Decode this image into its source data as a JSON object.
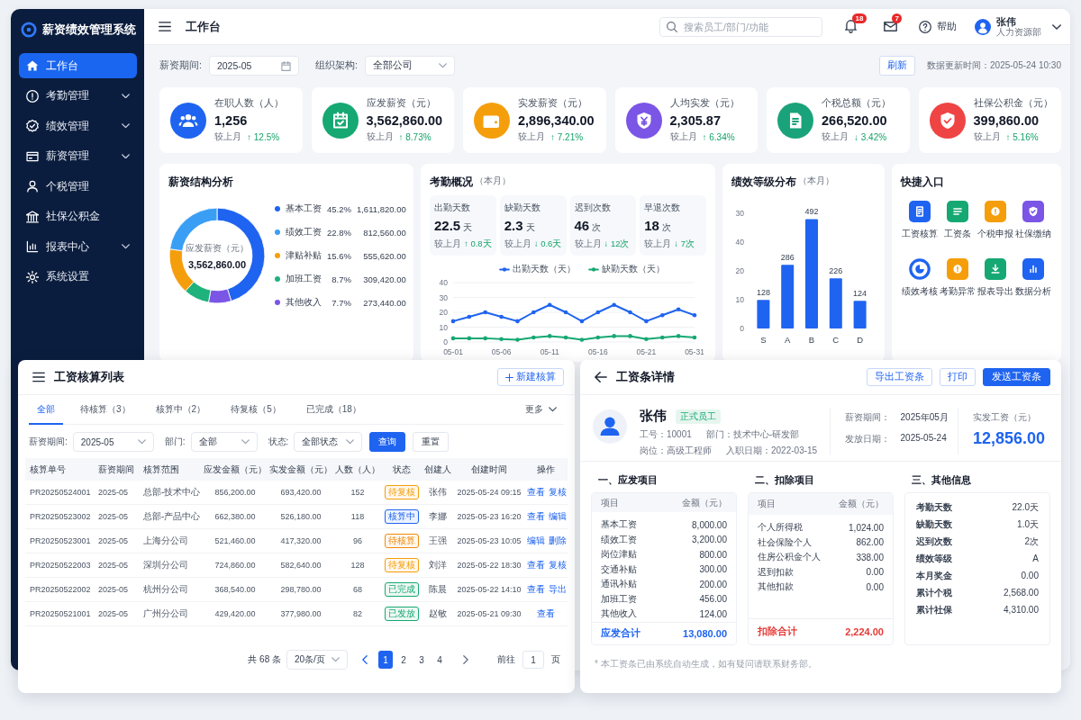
{
  "sidebar": {
    "title": "薪资绩效管理系统",
    "items": [
      {
        "label": "工作台",
        "kind": "link",
        "selected": true
      },
      {
        "label": "考勤管理",
        "kind": "group",
        "selected": false
      },
      {
        "label": "绩效管理",
        "kind": "group",
        "selected": false
      },
      {
        "label": "薪资管理",
        "kind": "group",
        "selected": false
      },
      {
        "label": "个税管理",
        "kind": "link",
        "selected": false
      },
      {
        "label": "社保公积金",
        "kind": "link",
        "selected": false
      },
      {
        "label": "报表中心",
        "kind": "group",
        "selected": false
      },
      {
        "label": "系统设置",
        "kind": "link",
        "selected": false
      }
    ]
  },
  "header": {
    "title": "工作台",
    "search": {
      "placeholder": "搜索员工/部门/功能"
    },
    "notifications": {
      "count": "18"
    },
    "messages": {
      "count": "7"
    },
    "help": {
      "label": "帮助"
    },
    "user": {
      "name": "张伟",
      "department": "人力资源部"
    }
  },
  "filters": {
    "period": {
      "label": "薪资期间:",
      "value": "2025-05"
    },
    "org": {
      "label": "组织架构:",
      "value": "全部公司"
    },
    "refresh_button": "刷新",
    "updated_at": "数据更新时间：2025-05-24 10:30"
  },
  "stats": [
    {
      "label": "在职人数（人）",
      "value": "1,256",
      "compare_label": "较上月",
      "change": "↑ 12.5%",
      "color": "#1f64f0"
    },
    {
      "label": "应发薪资（元）",
      "value": "3,562,860.00",
      "compare_label": "较上月",
      "change": "↑ 8.73%",
      "color": "#16a873"
    },
    {
      "label": "实发薪资（元）",
      "value": "2,896,340.00",
      "compare_label": "较上月",
      "change": "↑ 7.21%",
      "color": "#f59e0b"
    },
    {
      "label": "人均实发（元）",
      "value": "2,305.87",
      "compare_label": "较上月",
      "change": "↑ 6.34%",
      "color": "#7b55e6"
    },
    {
      "label": "个税总额（元）",
      "value": "266,520.00",
      "compare_label": "较上月",
      "change": "↓ 3.42%",
      "color": "#1aa37a"
    },
    {
      "label": "社保公积金（元）",
      "value": "399,860.00",
      "compare_label": "较上月",
      "change": "↑ 5.16%",
      "color": "#ef4444"
    }
  ],
  "salary_structure": {
    "title": "薪资结构分析",
    "center_label": "应发薪资（元）",
    "center_value": "3,562,860.00",
    "chart_data": {
      "type": "donut",
      "categories": [
        "基本工资",
        "绩效工资",
        "津贴补贴",
        "加班工资",
        "其他收入"
      ],
      "values": [
        45.2,
        22.8,
        15.6,
        8.7,
        7.7
      ]
    },
    "legend": [
      {
        "percent": "45.2%",
        "amount": "1,611,820.00",
        "color": "#1f64f0"
      },
      {
        "percent": "22.8%",
        "amount": "812,560.00",
        "color": "#3b9ef5"
      },
      {
        "percent": "15.6%",
        "amount": "555,620.00",
        "color": "#f59e0b"
      },
      {
        "percent": "8.7%",
        "amount": "309,420.00",
        "color": "#1fb27d"
      },
      {
        "percent": "7.7%",
        "amount": "273,440.00",
        "color": "#7b55e6"
      }
    ]
  },
  "attendance": {
    "title": "考勤概况",
    "title_note": "（本月）",
    "metrics": [
      {
        "label": "出勤天数",
        "value": "22.5",
        "unit": "天",
        "compare_label": "较上月",
        "change": "↑ 0.8天"
      },
      {
        "label": "缺勤天数",
        "value": "2.3",
        "unit": "天",
        "compare_label": "较上月",
        "change": "↓ 0.6天"
      },
      {
        "label": "迟到次数",
        "value": "46",
        "unit": "次",
        "compare_label": "较上月",
        "change": "↓ 12次"
      },
      {
        "label": "早退次数",
        "value": "18",
        "unit": "次",
        "compare_label": "较上月",
        "change": "↓ 7次"
      }
    ],
    "chart_data": {
      "type": "line",
      "categories": [
        "05-01",
        null,
        null,
        "05-06",
        null,
        null,
        "05-11",
        null,
        null,
        "05-16",
        null,
        null,
        "05-21",
        null,
        null,
        "05-31"
      ],
      "ylim": [
        0,
        40
      ],
      "yticks": [
        0,
        10,
        20,
        30,
        40
      ],
      "grid": true,
      "legend": "top",
      "series": [
        {
          "name": "出勤天数（天）",
          "color": "#1f64f0",
          "values": [
            14,
            17,
            20,
            17,
            14,
            20,
            25,
            20,
            14,
            20,
            25,
            20,
            14,
            18,
            22,
            18
          ]
        },
        {
          "name": "缺勤天数（天）",
          "color": "#16a873",
          "values": [
            2.5,
            2.5,
            2.5,
            2,
            1.5,
            3,
            4,
            3,
            1.5,
            3,
            4,
            4,
            2,
            3,
            4,
            3
          ]
        }
      ]
    }
  },
  "performance": {
    "title": "绩效等级分布",
    "title_note": "（本月）",
    "y_axis_labels": [
      "30",
      "40",
      "20",
      "10",
      "0"
    ],
    "chart_data": {
      "type": "bar",
      "categories": [
        "S",
        "A",
        "B",
        "C",
        "D"
      ],
      "values": [
        128,
        286,
        492,
        226,
        124
      ],
      "data_labels": true
    }
  },
  "quick_entry": {
    "title": "快捷入口",
    "items": [
      {
        "label": "工资核算",
        "color": "#1f64f0"
      },
      {
        "label": "工资条",
        "color": "#16a873"
      },
      {
        "label": "个税申报",
        "color": "#f59e0b"
      },
      {
        "label": "社保缴纳",
        "color": "#7b55e6"
      },
      {
        "label": "绩效考核",
        "color": "#1f64f0"
      },
      {
        "label": "考勤异常",
        "color": "#f59e0b"
      },
      {
        "label": "报表导出",
        "color": "#16a873"
      },
      {
        "label": "数据分析",
        "color": "#1f64f0"
      }
    ]
  },
  "payroll_list": {
    "title": "工资核算列表",
    "new_button": "新建核算",
    "tabs": [
      {
        "label": "全部",
        "selected": true
      },
      {
        "label": "待核算（3）",
        "selected": false
      },
      {
        "label": "核算中（2）",
        "selected": false
      },
      {
        "label": "待复核（5）",
        "selected": false
      },
      {
        "label": "已完成（18）",
        "selected": false
      }
    ],
    "more": "更多",
    "filters": [
      {
        "label": "薪资期间:",
        "value": "2025-05"
      },
      {
        "label": "部门:",
        "value": "全部"
      },
      {
        "label": "状态:",
        "value": "全部状态"
      }
    ],
    "query_button": "查询",
    "reset_button": "重置",
    "table": {
      "columns": [
        "核算单号",
        "薪资期间",
        "核算范围",
        "应发金额（元）",
        "实发金额（元）",
        "人数（人）",
        "状态",
        "创建人",
        "创建时间",
        "操作"
      ],
      "rows": [
        {
          "cells": [
            "PR20250524001",
            "2025-05",
            "总部-技术中心",
            "856,200.00",
            "693,420.00",
            "152"
          ],
          "status": {
            "label": "待复核",
            "color": "#f59e0b"
          },
          "creator": "张伟",
          "created_at": "2025-05-24 09:15",
          "actions": [
            "查看",
            "复核"
          ]
        },
        {
          "cells": [
            "PR20250523002",
            "2025-05",
            "总部-产品中心",
            "662,380.00",
            "526,180.00",
            "118"
          ],
          "status": {
            "label": "核算中",
            "color": "#1f64f0"
          },
          "creator": "李娜",
          "created_at": "2025-05-23 16:20",
          "actions": [
            "查看",
            "编辑"
          ]
        },
        {
          "cells": [
            "PR20250523001",
            "2025-05",
            "上海分公司",
            "521,460.00",
            "417,320.00",
            "96"
          ],
          "status": {
            "label": "待核算",
            "color": "#f08c0c"
          },
          "creator": "王强",
          "created_at": "2025-05-23 10:05",
          "actions": [
            "编辑",
            "删除"
          ]
        },
        {
          "cells": [
            "PR20250522003",
            "2025-05",
            "深圳分公司",
            "724,860.00",
            "582,640.00",
            "128"
          ],
          "status": {
            "label": "待复核",
            "color": "#f59e0b"
          },
          "creator": "刘洋",
          "created_at": "2025-05-22 18:30",
          "actions": [
            "查看",
            "复核"
          ]
        },
        {
          "cells": [
            "PR20250522002",
            "2025-05",
            "杭州分公司",
            "368,540.00",
            "298,780.00",
            "68"
          ],
          "status": {
            "label": "已完成",
            "color": "#16a873"
          },
          "creator": "陈晨",
          "created_at": "2025-05-22 14:10",
          "actions": [
            "查看",
            "导出"
          ]
        },
        {
          "cells": [
            "PR20250521001",
            "2025-05",
            "广州分公司",
            "429,420.00",
            "377,980.00",
            "82"
          ],
          "status": {
            "label": "已发放",
            "color": "#16a873"
          },
          "creator": "赵敏",
          "created_at": "2025-05-21 09:30",
          "actions": [
            "查看"
          ]
        }
      ]
    },
    "pagination": {
      "total": "共 68 条",
      "page_size": "20条/页",
      "pages": [
        {
          "label": "1",
          "selected": true
        },
        {
          "label": "2",
          "selected": false
        },
        {
          "label": "3",
          "selected": false
        },
        {
          "label": "4",
          "selected": false
        }
      ],
      "goto_label": "前往",
      "goto_value": "1",
      "goto_suffix": "页"
    }
  },
  "payslip": {
    "title": "工资条详情",
    "buttons": [
      {
        "label": "导出工资条",
        "kind": "secondary"
      },
      {
        "label": "打印",
        "kind": "secondary"
      },
      {
        "label": "发送工资条",
        "kind": "primary"
      }
    ],
    "employee": {
      "name": "张伟",
      "tag": "正式员工",
      "id": "工号：10001",
      "department": "部门：技术中心-研发部",
      "position": "岗位：高级工程师",
      "hire_date": "入职日期：2022-03-15"
    },
    "period_label": "薪资期间：",
    "period": "2025年05月",
    "pay_date_label": "发放日期：",
    "pay_date": "2025-05-24",
    "net_label": "实发工资（元）",
    "net_value": "12,856.00",
    "sections": [
      {
        "title": "一、应发项目",
        "kind": "table",
        "header": [
          "项目",
          "金额（元）"
        ],
        "rows": [
          {
            "label": "基本工资",
            "value": "8,000.00"
          },
          {
            "label": "绩效工资",
            "value": "3,200.00"
          },
          {
            "label": "岗位津贴",
            "value": "800.00"
          },
          {
            "label": "交通补贴",
            "value": "300.00"
          },
          {
            "label": "通讯补贴",
            "value": "200.00"
          },
          {
            "label": "加班工资",
            "value": "456.00"
          },
          {
            "label": "其他收入",
            "value": "124.00"
          }
        ],
        "total": {
          "label": "应发合计",
          "value": "13,080.00",
          "color": "#1f64f0"
        }
      },
      {
        "title": "二、扣除项目",
        "kind": "table",
        "header": [
          "项目",
          "金额（元）"
        ],
        "rows": [
          {
            "label": "个人所得税",
            "value": "1,024.00"
          },
          {
            "label": "社会保险个人",
            "value": "862.00"
          },
          {
            "label": "住房公积金个人",
            "value": "338.00"
          },
          {
            "label": "迟到扣款",
            "value": "0.00"
          },
          {
            "label": "其他扣款",
            "value": "0.00"
          }
        ],
        "total": {
          "label": "扣除合计",
          "value": "2,224.00",
          "color": "#e53935"
        }
      },
      {
        "title": "三、其他信息",
        "kind": "list",
        "rows": [
          {
            "label": "考勤天数",
            "value": "22.0天"
          },
          {
            "label": "缺勤天数",
            "value": "1.0天"
          },
          {
            "label": "迟到次数",
            "value": "2次"
          },
          {
            "label": "绩效等级",
            "value": "A"
          },
          {
            "label": "本月奖金",
            "value": "0.00"
          },
          {
            "label": "累计个税",
            "value": "2,568.00"
          },
          {
            "label": "累计社保",
            "value": "4,310.00"
          }
        ]
      }
    ],
    "footnote": "* 本工资条已由系统自动生成，如有疑问请联系财务部。"
  }
}
